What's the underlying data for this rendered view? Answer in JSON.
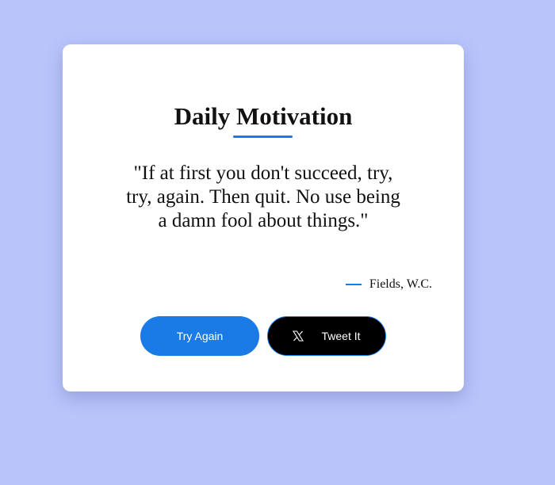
{
  "colors": {
    "background": "#b9c4fb",
    "card": "#ffffff",
    "accent": "#1a7ae6",
    "tweet_button": "#000000"
  },
  "card": {
    "title": "Daily Motivation",
    "quote": "\"If at first you don't succeed, try, try, again. Then quit. No use being a damn fool about things.\"",
    "author": "Fields, W.C."
  },
  "buttons": {
    "try_again_label": "Try Again",
    "tweet_label": "Tweet It",
    "tweet_icon": "x-logo-icon"
  }
}
